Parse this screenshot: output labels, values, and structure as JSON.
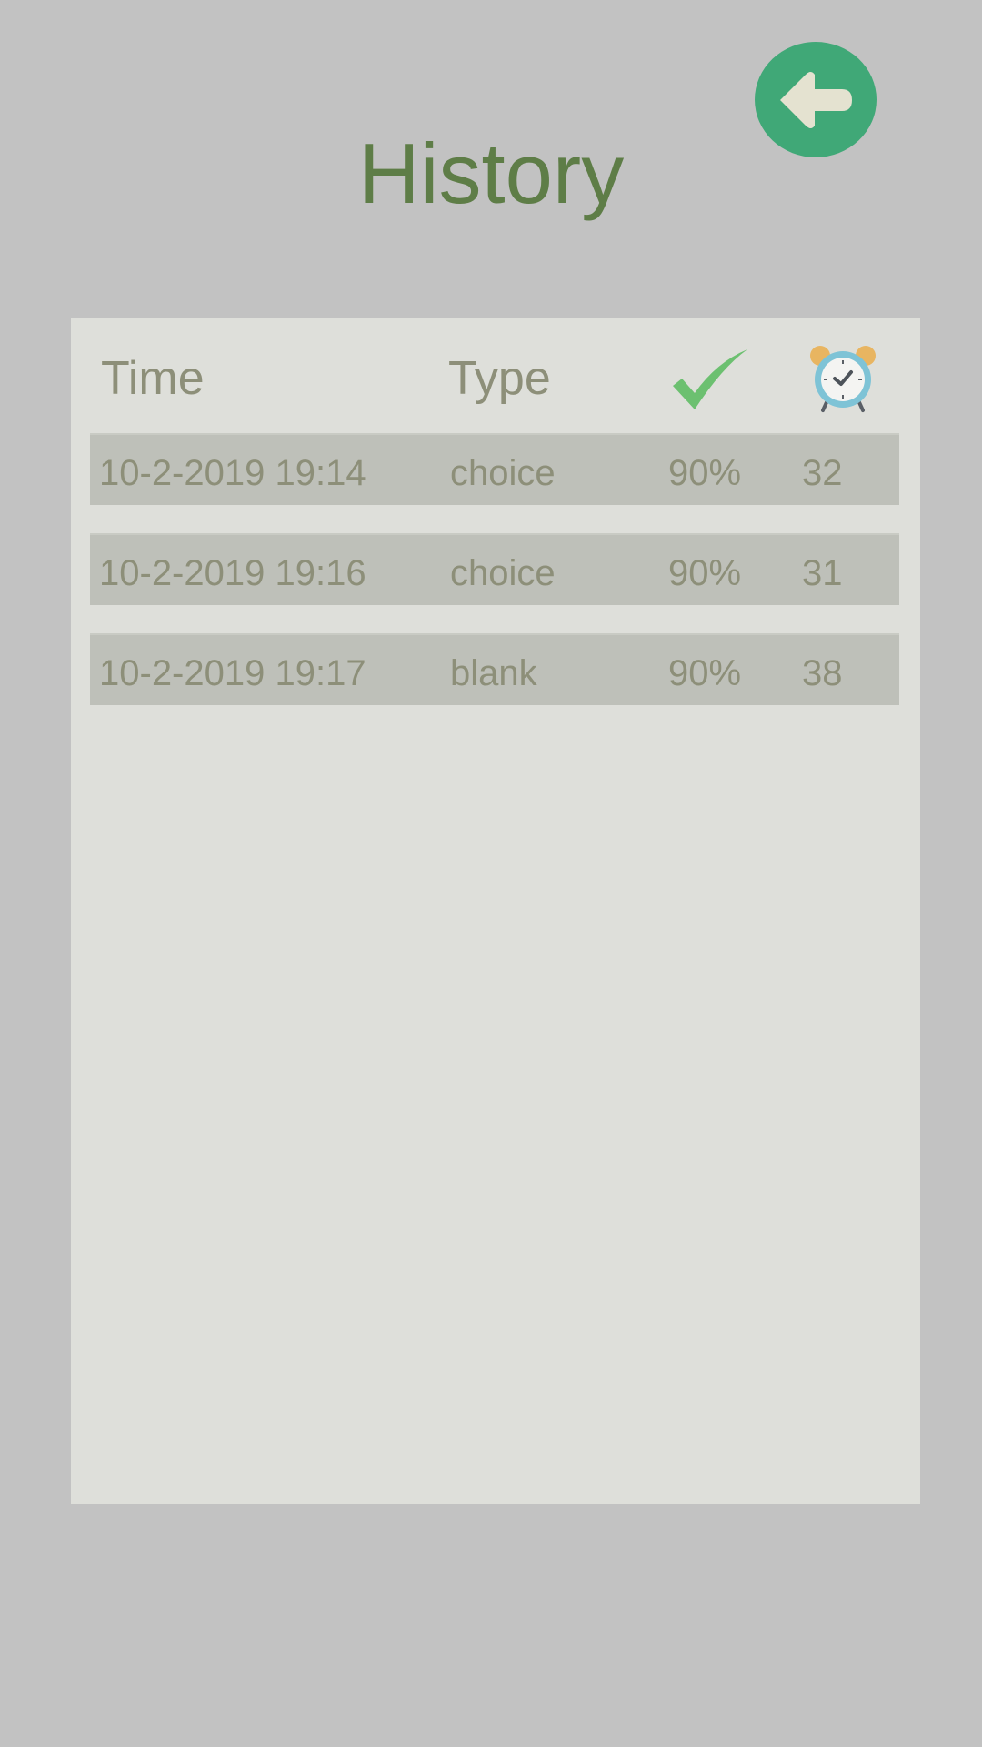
{
  "header": {
    "title": "History"
  },
  "table": {
    "columns": {
      "time": "Time",
      "type": "Type",
      "correct_icon": "checkmark-icon",
      "duration_icon": "alarm-clock-icon"
    },
    "rows": [
      {
        "time": "10-2-2019 19:14",
        "type": "choice",
        "correct": "90%",
        "seconds": "32"
      },
      {
        "time": "10-2-2019 19:16",
        "type": "choice",
        "correct": "90%",
        "seconds": "31"
      },
      {
        "time": "10-2-2019 19:17",
        "type": "blank",
        "correct": "90%",
        "seconds": "38"
      }
    ]
  },
  "colors": {
    "background": "#c2c2c2",
    "panel": "#dedfda",
    "row": "#bec0b9",
    "title": "#5e7d47",
    "text": "#8d8f79",
    "back_button": "#40a877",
    "checkmark": "#6cc070"
  }
}
